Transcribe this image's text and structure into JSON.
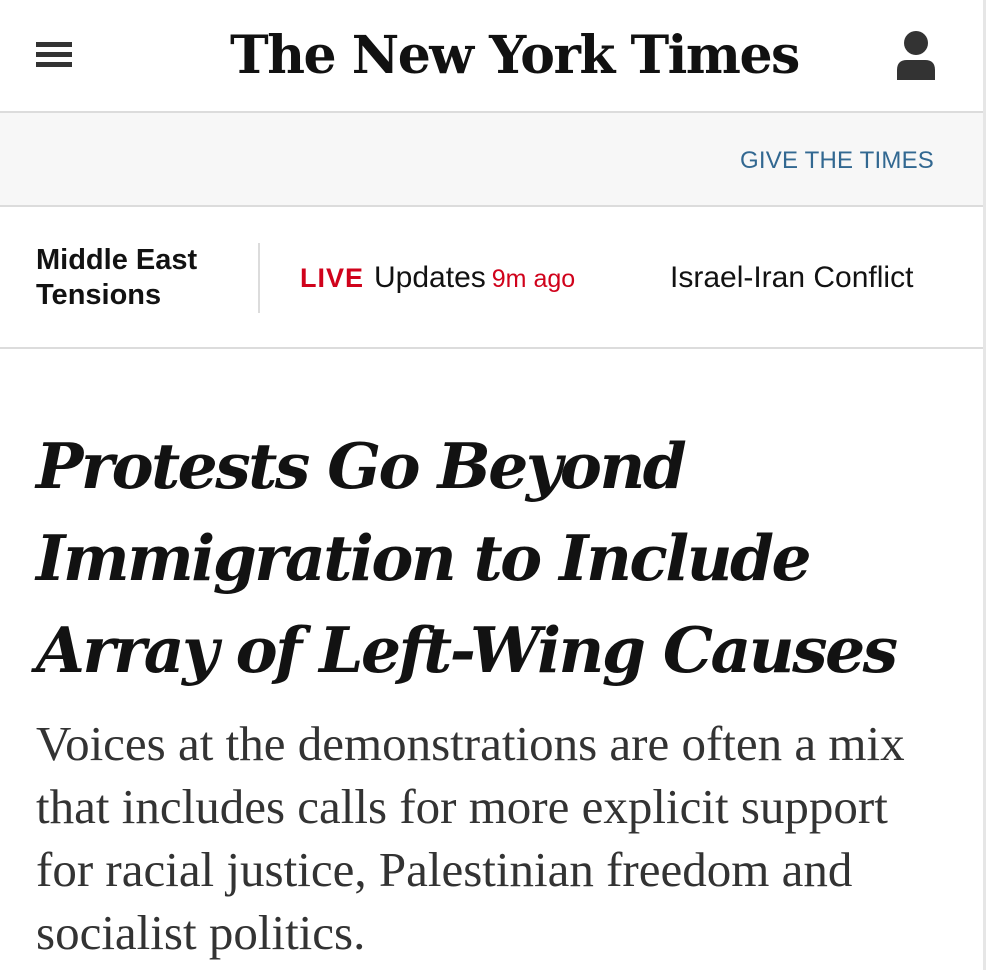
{
  "header": {
    "logo_text": "The New York Times",
    "menu_icon": "hamburger-menu-icon",
    "account_icon": "user-account-icon"
  },
  "promo": {
    "give_label": "GIVE THE TIMES"
  },
  "topic_bar": {
    "section_label": "Middle East Tensions",
    "live_badge": "LIVE",
    "live_text": "Updates",
    "live_time": "9m ago",
    "conflict_label": "Israel-Iran Conflict"
  },
  "article": {
    "headline": "Protests Go Beyond Immigration to Include Array of Left-Wing Causes",
    "summary": "Voices at the demonstrations are often a mix that includes calls for more explicit support for racial justice, Palestinian freedom and socialist politics."
  },
  "colors": {
    "accent_blue": "#326891",
    "live_red": "#d0021b",
    "text": "#121212",
    "promo_background": "#f7f7f7",
    "divider": "#dcdcdc"
  }
}
